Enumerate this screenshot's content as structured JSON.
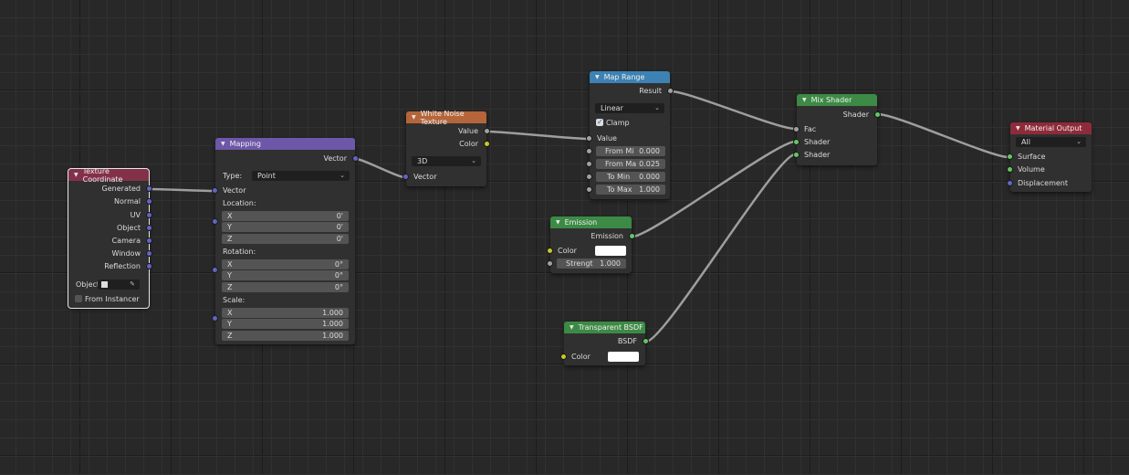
{
  "colors": {
    "background": "#282828",
    "header_input": "#83314a",
    "header_vector": "#6c57a8",
    "header_texture": "#b4663a",
    "header_converter": "#3d82b4",
    "header_shader": "#3c8a45",
    "header_output": "#8e2b3a",
    "socket_vector": "#6363c7",
    "socket_color": "#c7c729",
    "socket_value": "#a1a1a1",
    "socket_shader": "#63c763",
    "wire": "#9e9e9e"
  },
  "texture_coordinate": {
    "title": "Texture Coordinate",
    "outputs": [
      "Generated",
      "Normal",
      "UV",
      "Object",
      "Camera",
      "Window",
      "Reflection"
    ],
    "object_label": "Object",
    "from_instancer_label": "From Instancer"
  },
  "mapping": {
    "title": "Mapping",
    "output_vector": "Vector",
    "type_label": "Type:",
    "type_value": "Point",
    "input_vector": "Vector",
    "location_label": "Location:",
    "location": [
      {
        "axis": "X",
        "value": "0'"
      },
      {
        "axis": "Y",
        "value": "0'"
      },
      {
        "axis": "Z",
        "value": "0'"
      }
    ],
    "rotation_label": "Rotation:",
    "rotation": [
      {
        "axis": "X",
        "value": "0°"
      },
      {
        "axis": "Y",
        "value": "0°"
      },
      {
        "axis": "Z",
        "value": "0°"
      }
    ],
    "scale_label": "Scale:",
    "scale": [
      {
        "axis": "X",
        "value": "1.000"
      },
      {
        "axis": "Y",
        "value": "1.000"
      },
      {
        "axis": "Z",
        "value": "1.000"
      }
    ]
  },
  "white_noise": {
    "title": "White Noise Texture",
    "out_value": "Value",
    "out_color": "Color",
    "dimensions": "3D",
    "in_vector": "Vector"
  },
  "map_range": {
    "title": "Map Range",
    "out_result": "Result",
    "interpolation": "Linear",
    "clamp_label": "Clamp",
    "in_value": "Value",
    "fields": [
      {
        "label": "From Mi",
        "value": "0.000"
      },
      {
        "label": "From Ma",
        "value": "0.025"
      },
      {
        "label": "To Min",
        "value": "0.000"
      },
      {
        "label": "To Max",
        "value": "1.000"
      }
    ]
  },
  "emission": {
    "title": "Emission",
    "out_emission": "Emission",
    "color_label": "Color",
    "strength_label": "Strengt",
    "strength_value": "1.000"
  },
  "transparent": {
    "title": "Transparent BSDF",
    "out_bsdf": "BSDF",
    "color_label": "Color"
  },
  "mix_shader": {
    "title": "Mix Shader",
    "out_shader": "Shader",
    "in_fac": "Fac",
    "in_shader1": "Shader",
    "in_shader2": "Shader"
  },
  "material_output": {
    "title": "Material Output",
    "target": "All",
    "in_surface": "Surface",
    "in_volume": "Volume",
    "in_displacement": "Displacement"
  }
}
